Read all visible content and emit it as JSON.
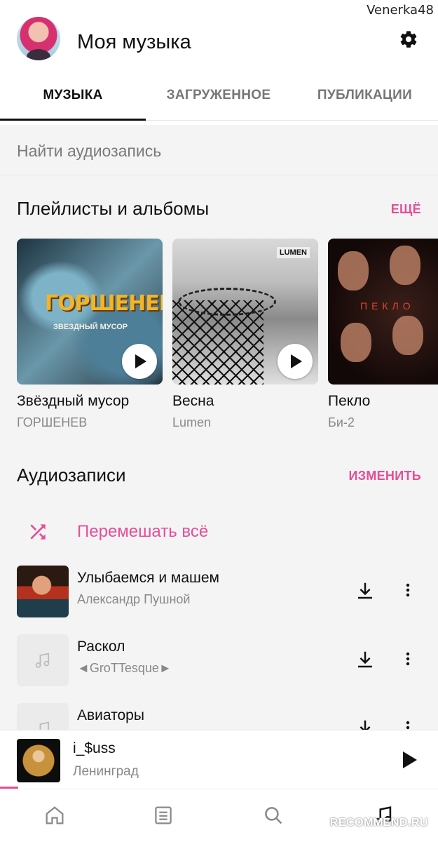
{
  "overlay": {
    "username": "Venerka48",
    "brand": "RECOMMEND.RU"
  },
  "header": {
    "title": "Моя музыка",
    "avatar_icon": "user-avatar",
    "settings_icon": "gear-icon"
  },
  "tabs": [
    {
      "label": "МУЗЫКА",
      "active": true
    },
    {
      "label": "ЗАГРУЖЕННОЕ",
      "active": false
    },
    {
      "label": "ПУБЛИКАЦИИ",
      "active": false
    }
  ],
  "search": {
    "placeholder": "Найти аудиозапись"
  },
  "playlists": {
    "title": "Плейлисты и альбомы",
    "more_label": "ЕЩЁ",
    "items": [
      {
        "title": "Звёздный мусор",
        "artist": "ГОРШЕНЕВ",
        "cover_text": "ГОРШЕНЕВ",
        "cover_sub": "ЗВЕЗДНЫЙ МУСОР"
      },
      {
        "title": "Весна",
        "artist": "Lumen",
        "cover_text": "LUMEN"
      },
      {
        "title": "Пекло",
        "artist": "Би-2",
        "cover_text": "ПЕКЛО"
      }
    ]
  },
  "audio": {
    "title": "Аудиозаписи",
    "edit_label": "ИЗМЕНИТЬ",
    "shuffle_label": "Перемешать всё",
    "tracks": [
      {
        "title": "Улыбаемся и машем",
        "artist": "Александр Пушной",
        "has_cover": true
      },
      {
        "title": "Раскол",
        "artist": "◄GroTTesque►",
        "has_cover": false
      },
      {
        "title": "Авиаторы",
        "artist": "",
        "has_cover": false
      }
    ]
  },
  "now_playing": {
    "title": "i_$uss",
    "artist": "Ленинград",
    "progress": 0.04
  },
  "bottom_nav": [
    {
      "icon": "home-icon",
      "active": false
    },
    {
      "icon": "feed-icon",
      "active": false
    },
    {
      "icon": "search-icon",
      "active": false
    },
    {
      "icon": "music-note-icon",
      "active": true
    }
  ],
  "colors": {
    "accent": "#e64e97",
    "text": "#111111",
    "muted": "#888888",
    "surface": "#f4f4f4"
  }
}
